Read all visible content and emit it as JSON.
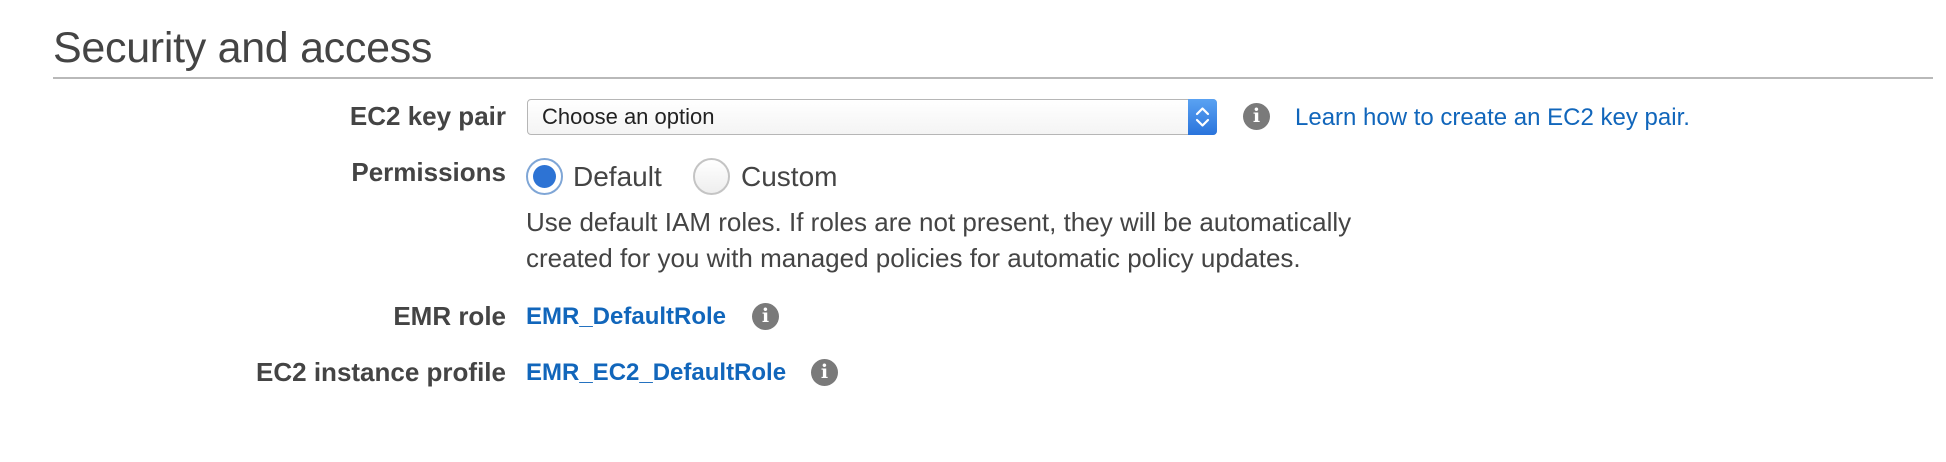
{
  "section": {
    "title": "Security and access"
  },
  "key_pair": {
    "label": "EC2 key pair",
    "select_value": "Choose an option",
    "help_link": "Learn how to create an EC2 key pair."
  },
  "permissions": {
    "label": "Permissions",
    "options": [
      {
        "label": "Default",
        "selected": true
      },
      {
        "label": "Custom",
        "selected": false
      }
    ],
    "description_line1": "Use default IAM roles. If roles are not present, they will be automatically",
    "description_line2": "created for you with managed policies for automatic policy updates."
  },
  "emr_role": {
    "label": "EMR role",
    "value": "EMR_DefaultRole"
  },
  "instance_profile": {
    "label": "EC2 instance profile",
    "value": "EMR_EC2_DefaultRole"
  },
  "icons": {
    "info": "info-icon",
    "select_arrows": "chevron-up-down-icon"
  },
  "colors": {
    "link": "#1166bb",
    "accent": "#2d73d4",
    "info_icon": "#7a7a7a"
  }
}
